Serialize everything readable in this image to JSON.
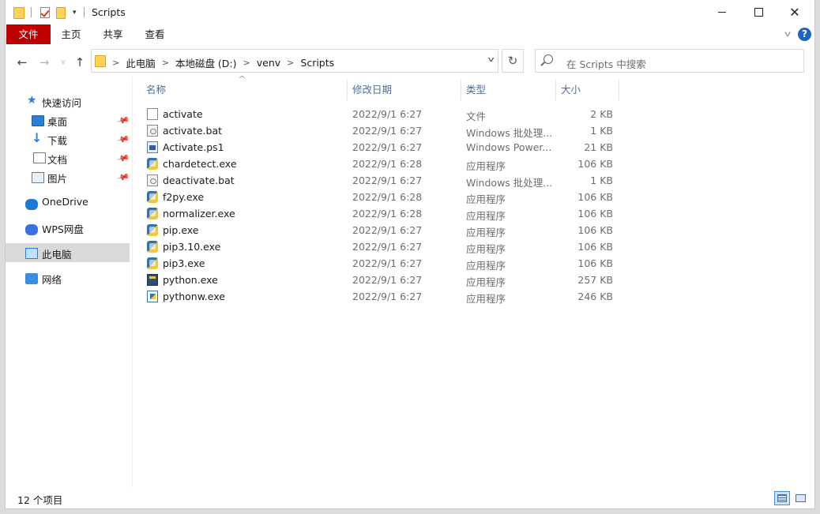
{
  "window": {
    "title": "Scripts"
  },
  "ribbon": {
    "tabs": [
      "文件",
      "主页",
      "共享",
      "查看"
    ],
    "help": "?"
  },
  "address": {
    "crumbs": [
      "此电脑",
      "本地磁盘 (D:)",
      "venv",
      "Scripts"
    ],
    "search_placeholder": "在 Scripts 中搜索"
  },
  "nav": {
    "items": [
      {
        "label": "快速访问",
        "icon": "star-icon"
      },
      {
        "label": "桌面",
        "icon": "desktop-icon",
        "pinned": true
      },
      {
        "label": "下载",
        "icon": "download-icon",
        "pinned": true
      },
      {
        "label": "文档",
        "icon": "document-icon",
        "pinned": true
      },
      {
        "label": "图片",
        "icon": "picture-icon",
        "pinned": true
      },
      {
        "label": "OneDrive",
        "icon": "cloud-icon"
      },
      {
        "label": "WPS网盘",
        "icon": "wps-cloud-icon"
      },
      {
        "label": "此电脑",
        "icon": "computer-icon",
        "selected": true
      },
      {
        "label": "网络",
        "icon": "network-icon"
      }
    ]
  },
  "columns": {
    "name": "名称",
    "date": "修改日期",
    "type": "类型",
    "size": "大小"
  },
  "files": [
    {
      "name": "activate",
      "date": "2022/9/1 6:27",
      "type": "文件",
      "size": "2 KB",
      "icon": "file-icon"
    },
    {
      "name": "activate.bat",
      "date": "2022/9/1 6:27",
      "type": "Windows 批处理...",
      "size": "1 KB",
      "icon": "batch-file-icon"
    },
    {
      "name": "Activate.ps1",
      "date": "2022/9/1 6:27",
      "type": "Windows Power...",
      "size": "21 KB",
      "icon": "powershell-icon"
    },
    {
      "name": "chardetect.exe",
      "date": "2022/9/1 6:28",
      "type": "应用程序",
      "size": "106 KB",
      "icon": "python-exe-icon"
    },
    {
      "name": "deactivate.bat",
      "date": "2022/9/1 6:27",
      "type": "Windows 批处理...",
      "size": "1 KB",
      "icon": "batch-file-icon"
    },
    {
      "name": "f2py.exe",
      "date": "2022/9/1 6:28",
      "type": "应用程序",
      "size": "106 KB",
      "icon": "python-exe-icon"
    },
    {
      "name": "normalizer.exe",
      "date": "2022/9/1 6:28",
      "type": "应用程序",
      "size": "106 KB",
      "icon": "python-exe-icon"
    },
    {
      "name": "pip.exe",
      "date": "2022/9/1 6:27",
      "type": "应用程序",
      "size": "106 KB",
      "icon": "python-exe-icon"
    },
    {
      "name": "pip3.10.exe",
      "date": "2022/9/1 6:27",
      "type": "应用程序",
      "size": "106 KB",
      "icon": "python-exe-icon"
    },
    {
      "name": "pip3.exe",
      "date": "2022/9/1 6:27",
      "type": "应用程序",
      "size": "106 KB",
      "icon": "python-exe-icon"
    },
    {
      "name": "python.exe",
      "date": "2022/9/1 6:27",
      "type": "应用程序",
      "size": "257 KB",
      "icon": "python-console-icon"
    },
    {
      "name": "pythonw.exe",
      "date": "2022/9/1 6:27",
      "type": "应用程序",
      "size": "246 KB",
      "icon": "python-window-icon"
    }
  ],
  "status": {
    "count": "12 个项目"
  },
  "colors": {
    "file_tab": "#c00000",
    "accent": "#1f63c9",
    "selected": "#d9d9d9"
  }
}
